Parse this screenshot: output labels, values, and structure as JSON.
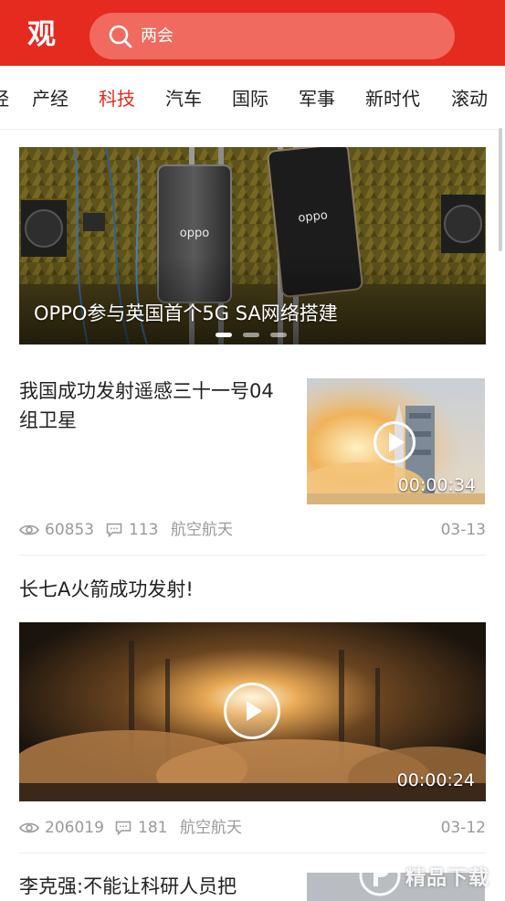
{
  "header": {
    "logo_text": "观",
    "search_text": "两会",
    "colors": {
      "brand": "#e52a1f",
      "search_bg": "#f06a5f"
    }
  },
  "tabs": [
    {
      "label": "经",
      "active": false
    },
    {
      "label": "产经",
      "active": false
    },
    {
      "label": "科技",
      "active": true
    },
    {
      "label": "汽车",
      "active": false
    },
    {
      "label": "国际",
      "active": false
    },
    {
      "label": "军事",
      "active": false
    },
    {
      "label": "新时代",
      "active": false
    },
    {
      "label": "滚动",
      "active": false
    }
  ],
  "hero": {
    "caption": "OPPO参与英国首个5G SA网络搭建",
    "phone_brand_1": "oppo",
    "phone_brand_2": "oppo",
    "carousel": {
      "count": 3,
      "active_index": 0
    }
  },
  "articles": [
    {
      "title": "我国成功发射遥感三十一号04组卫星",
      "duration": "00:00:34",
      "views": "60853",
      "comments": "113",
      "category": "航空航天",
      "date": "03-13"
    },
    {
      "title": "长七A火箭成功发射!",
      "duration": "00:00:24",
      "views": "206019",
      "comments": "181",
      "category": "航空航天",
      "date": "03-12"
    },
    {
      "title": "李克强:不能让科研人员把"
    }
  ],
  "watermark": {
    "text": "精品下载"
  }
}
